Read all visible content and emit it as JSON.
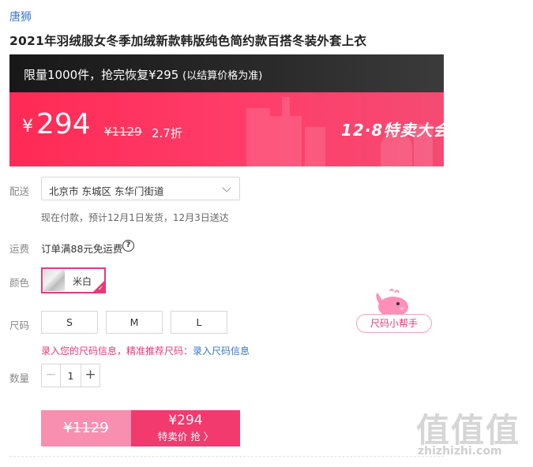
{
  "brand": "唐狮",
  "product_title": "2021年羽绒服女冬季加绒新款韩版纯色简约款百搭冬装外套上衣",
  "banner": {
    "limit_text": "限量1000件，抢完恢复¥295",
    "limit_note": "(以结算价格为准)",
    "currency": "¥",
    "price": "294",
    "original_price": "¥1129",
    "discount": "2.7折",
    "event_name": "12·8特卖大会",
    "color_primary": "#ff2a55",
    "color_dark": "#1c1c1c"
  },
  "delivery": {
    "label": "配送",
    "address": "北京市 东城区 东华门街道",
    "note": "现在付款，预计12月1日发货，12月3日送达"
  },
  "freight": {
    "label": "运费",
    "text": "订单满88元免运费",
    "help_icon": "question-circle-icon"
  },
  "color": {
    "label": "颜色",
    "option": "米白",
    "accent": "#e63a79"
  },
  "size": {
    "label": "尺码",
    "options": [
      "S",
      "M",
      "L"
    ],
    "tip_prefix": "录入您的尺码信息，精准推荐尺码：",
    "tip_link": "录入尺码信息",
    "helper_button": "尺码小帮手"
  },
  "quantity": {
    "label": "数量",
    "minus": "−",
    "value": "1",
    "plus": "+"
  },
  "buy": {
    "original_price": "¥1129",
    "price": "¥294",
    "action": "特卖价 抢 〉",
    "color": "#f23a6f"
  },
  "watermark": {
    "chars": "值值值",
    "url": "zhizhizhi.com"
  }
}
